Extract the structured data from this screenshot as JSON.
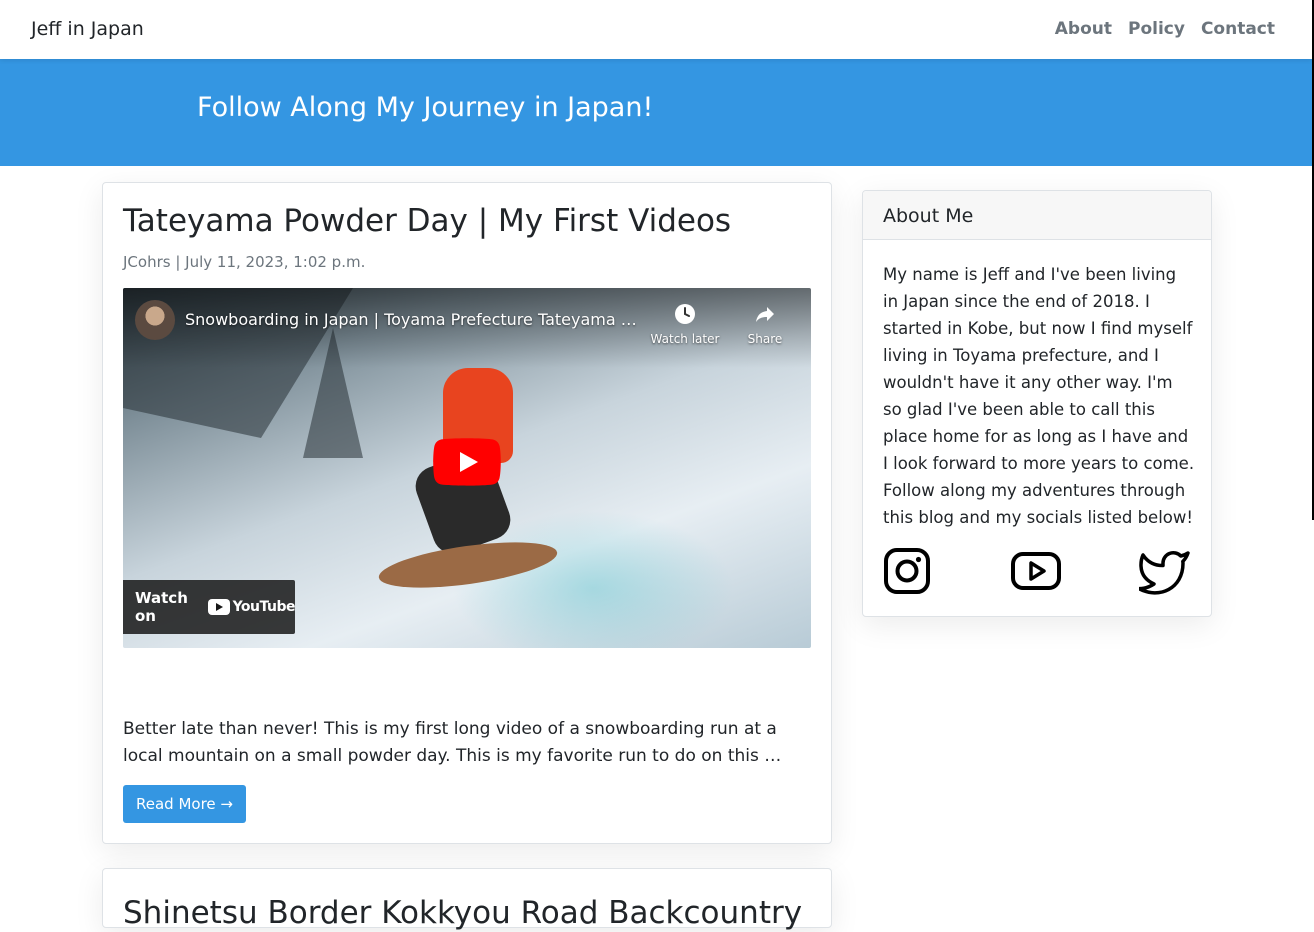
{
  "navbar": {
    "brand": "Jeff in Japan",
    "links": [
      "About",
      "Policy",
      "Contact"
    ]
  },
  "hero": {
    "title": "Follow Along My Journey in Japan!"
  },
  "posts": [
    {
      "title": "Tateyama Powder Day | My First Videos",
      "meta": "JCohrs | July 11, 2023, 1:02 p.m.",
      "video": {
        "title": "Snowboarding in Japan | Toyama Prefecture Tateyama Powder Day",
        "watch_later": "Watch later",
        "share": "Share",
        "watch_on": "Watch on",
        "provider": "YouTube"
      },
      "excerpt": "Better late than never! This is my first long video of a snowboarding run at a local mountain on a small powder day. This is my favorite run to do on this …",
      "read_more": "Read More →"
    },
    {
      "title": "Shinetsu Border Kokkyou Road Backcountry | 白"
    }
  ],
  "sidebar": {
    "header": "About Me",
    "body": "My name is Jeff and I've been living in Japan since the end of 2018. I started in Kobe, but now I find myself living in Toyama prefecture, and I wouldn't have it any other way. I'm so glad I've been able to call this place home for as long as I have and I look forward to more years to come. Follow along my adventures through this blog and my socials listed below!",
    "socials": [
      "instagram-icon",
      "youtube-icon",
      "twitter-icon"
    ]
  },
  "colors": {
    "accent": "#3496e2",
    "nav_link": "#6c757d",
    "youtube_red": "#ff0000"
  }
}
